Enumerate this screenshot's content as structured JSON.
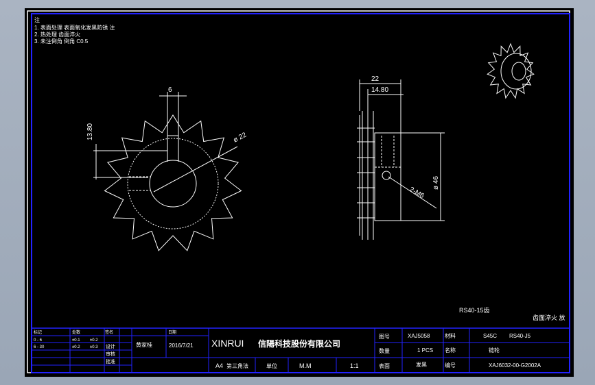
{
  "notes": {
    "heading": "注",
    "lines": [
      "1. 表面处理 表面氧化发黑防锈 注",
      "2. 热处理 齿面淬火",
      "3. 未注倒角 倒角 C0.5"
    ]
  },
  "front_view": {
    "dim_width": "6",
    "dim_height": "13.80",
    "dim_diameter": "ø 22"
  },
  "side_view": {
    "dim_total": "22",
    "dim_inner": "14.80",
    "dim_diameter": "ø 46",
    "thread_note": "2-M6"
  },
  "model_label": "RS40-15齿",
  "right_note": "齿面淬火 放",
  "title_block": {
    "company_latin": "XINRUI",
    "company_cn": "信陽科技股份有限公司",
    "designer": "黄家桂",
    "date": "2016/7/21",
    "paper": "A4",
    "angle": "第三角法",
    "unit_label": "单位",
    "unit": "M.M",
    "scale": "1:1",
    "drawing_no_label": "图号",
    "drawing_no": "XAJ5058",
    "material_label": "材料",
    "material": "S45C",
    "spec": "RS40-J5",
    "qty_label": "数量",
    "qty": "1  PCS",
    "name_label": "名称",
    "name": "链轮",
    "part_no_label": "编号",
    "part_no": "XAJ6032-00-G2002A",
    "surface_label": "表面",
    "surface": "发黑",
    "design_label": "设计",
    "check_label": "审核",
    "approve_label": "批准",
    "rev_headers": [
      "标记",
      "处数",
      "更改文件号",
      "签名",
      "日期"
    ],
    "rev_row2": [
      "0 - 6",
      "±0.1",
      "0.1",
      "±0.2"
    ],
    "rev_row3": [
      "6 - 30",
      "±0.2",
      "0.2",
      "±0.3"
    ]
  }
}
